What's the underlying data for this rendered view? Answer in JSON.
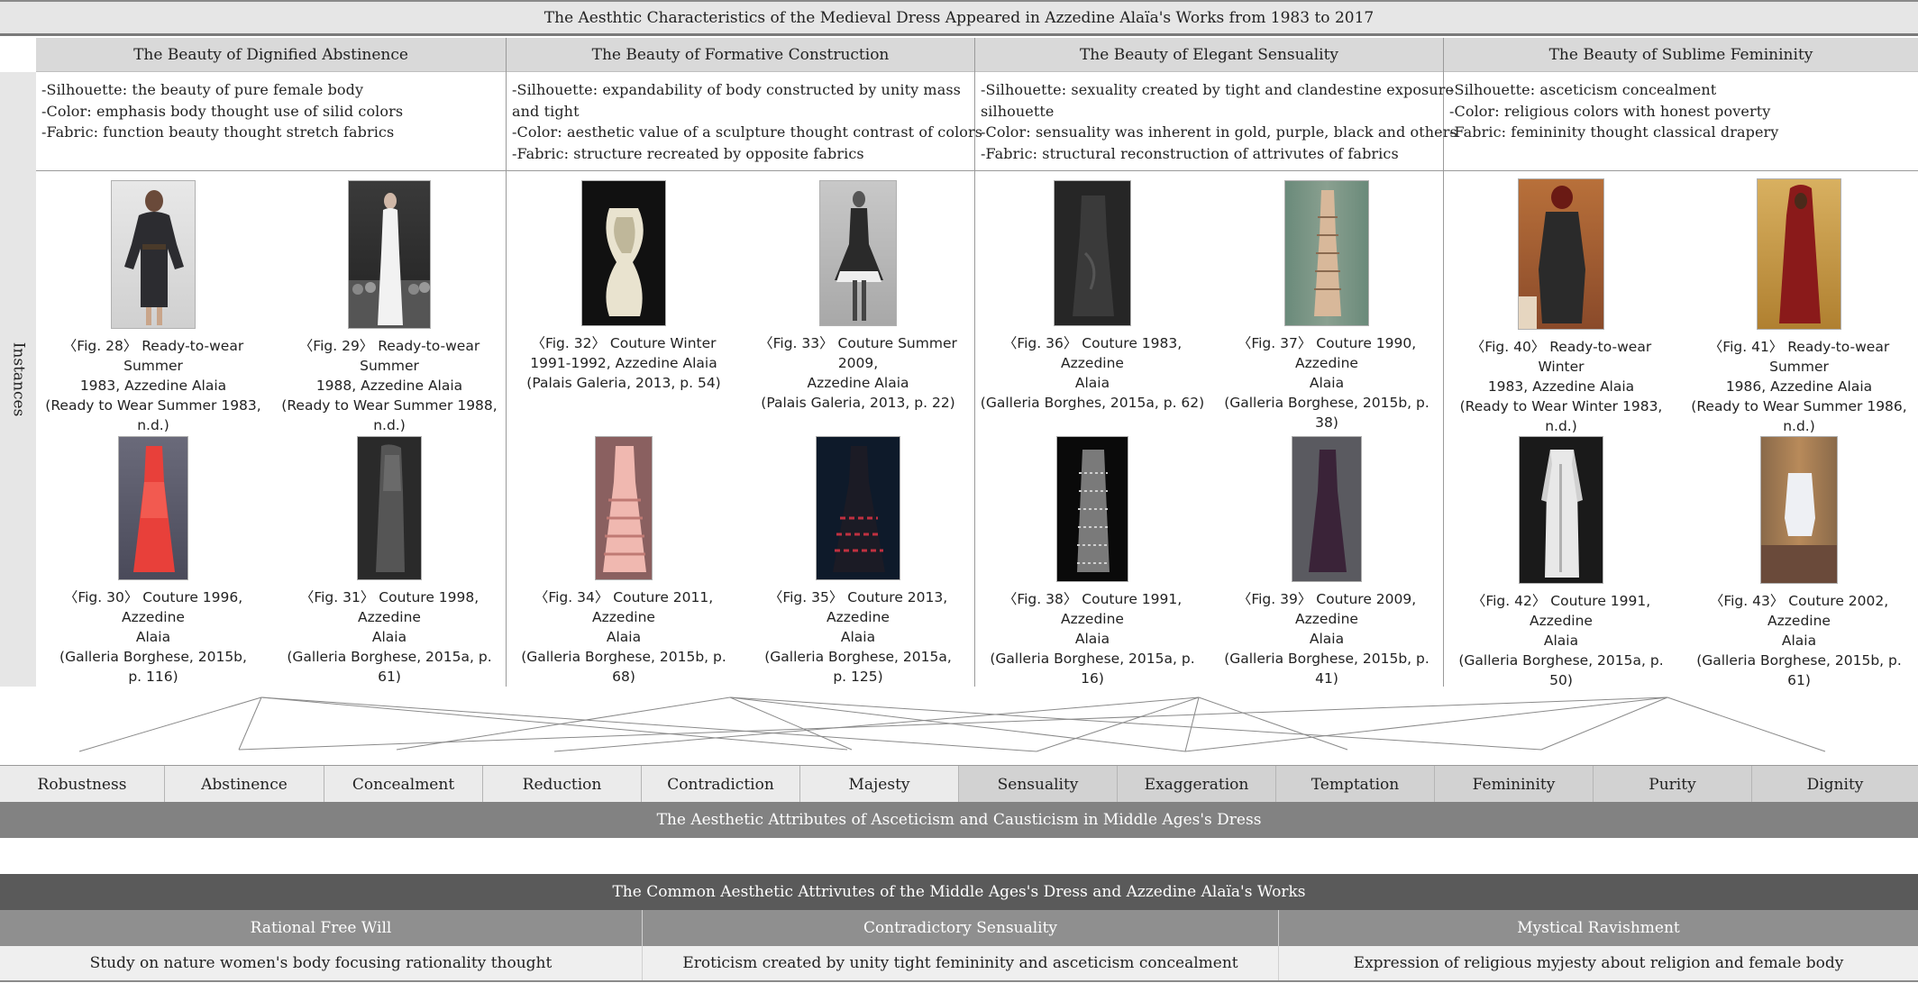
{
  "title": "The Aesthtic Characteristics of the Medieval Dress Appeared in Azzedine Alaïa's Works from 1983 to 2017",
  "instances_label": "Instances",
  "columns": [
    {
      "header": "The Beauty of Dignified Abstinence",
      "desc": [
        "-Silhouette: the beauty of pure female body",
        "-Color: emphasis body thought use of silid colors",
        "-Fabric: function beauty thought stretch fabrics"
      ],
      "figs": [
        {
          "caption": [
            "〈Fig. 28〉 Ready-to-wear Summer",
            "1983, Azzedine Alaia",
            "(Ready to Wear Summer 1983,",
            "n.d.)"
          ]
        },
        {
          "caption": [
            "〈Fig. 29〉 Ready-to-wear Summer",
            "1988, Azzedine Alaia",
            "(Ready to Wear Summer 1988,",
            "n.d.)"
          ]
        },
        {
          "caption": [
            "〈Fig. 30〉 Couture 1996, Azzedine",
            "Alaia",
            "(Galleria Borghese, 2015b,",
            "p. 116)"
          ]
        },
        {
          "caption": [
            "〈Fig. 31〉 Couture 1998, Azzedine",
            "Alaia",
            "(Galleria Borghese, 2015a, p. 61)"
          ]
        }
      ]
    },
    {
      "header": "The Beauty of Formative Construction",
      "desc": [
        "-Silhouette: expandability of body constructed by unity mass",
        " and tight",
        "-Color: aesthetic value of a sculpture thought contrast of colors",
        "-Fabric: structure recreated by opposite fabrics"
      ],
      "figs": [
        {
          "caption": [
            "〈Fig. 32〉 Couture Winter",
            "1991-1992, Azzedine Alaia",
            "(Palais Galeria, 2013, p. 54)"
          ]
        },
        {
          "caption": [
            "〈Fig. 33〉 Couture Summer 2009,",
            "Azzedine Alaia",
            "(Palais Galeria, 2013, p. 22)"
          ]
        },
        {
          "caption": [
            "〈Fig. 34〉 Couture 2011, Azzedine",
            "Alaia",
            "(Galleria Borghese, 2015b, p. 68)"
          ]
        },
        {
          "caption": [
            "〈Fig. 35〉 Couture 2013, Azzedine",
            "Alaia",
            "(Galleria Borghese, 2015a,",
            "p. 125)"
          ]
        }
      ]
    },
    {
      "header": "The Beauty of Elegant Sensuality",
      "desc": [
        "-Silhouette: sexuality created by tight and clandestine exposure",
        " silhouette",
        "-Color: sensuality was inherent in gold, purple, black and others",
        "-Fabric: structural reconstruction of attrivutes of fabrics"
      ],
      "figs": [
        {
          "caption": [
            "〈Fig. 36〉 Couture 1983, Azzedine",
            "Alaia",
            "(Galleria Borghes, 2015a, p. 62)"
          ]
        },
        {
          "caption": [
            "〈Fig. 37〉 Couture 1990, Azzedine",
            "Alaia",
            "(Galleria Borghese, 2015b, p. 38)"
          ]
        },
        {
          "caption": [
            "〈Fig. 38〉 Couture 1991, Azzedine",
            "Alaia",
            "(Galleria Borghese, 2015a, p. 16)"
          ]
        },
        {
          "caption": [
            "〈Fig. 39〉 Couture 2009, Azzedine",
            "Alaia",
            "(Galleria Borghese, 2015b, p. 41)"
          ]
        }
      ]
    },
    {
      "header": "The Beauty of Sublime Femininity",
      "desc": [
        "-Silhouette: asceticism concealment",
        "-Color: religious colors with honest poverty",
        "-Fabric: femininity thought classical drapery"
      ],
      "figs": [
        {
          "caption": [
            "〈Fig. 40〉 Ready-to-wear Winter",
            "1983, Azzedine Alaia",
            "(Ready to Wear Winter 1983,",
            "n.d.)"
          ]
        },
        {
          "caption": [
            "〈Fig. 41〉 Ready-to-wear Summer",
            "1986, Azzedine Alaia",
            "(Ready to Wear Summer 1986,",
            "n.d.)"
          ]
        },
        {
          "caption": [
            "〈Fig. 42〉 Couture 1991, Azzedine",
            "Alaia",
            "(Galleria Borghese, 2015a, p. 50)"
          ]
        },
        {
          "caption": [
            "〈Fig. 43〉 Couture 2002, Azzedine",
            "Alaia",
            "(Galleria Borghese, 2015b, p. 61)"
          ]
        }
      ]
    }
  ],
  "attributes": [
    "Robustness",
    "Abstinence",
    "Concealment",
    "Reduction",
    "Contradiction",
    "Majesty",
    "Sensuality",
    "Exaggeration",
    "Temptation",
    "Femininity",
    "Purity",
    "Dignity"
  ],
  "attributes_title": "The Aesthetic Attributes of Asceticism and Causticism in Middle Ages's Dress",
  "common": {
    "title": "The Common Aesthetic Attrivutes of the Middle Ages's Dress and Azzedine Alaïa's Works",
    "heads": [
      "Rational Free Will",
      "Contradictory Sensuality",
      "Mystical Ravishment"
    ],
    "bodies": [
      "Study on nature women's body focusing rationality thought",
      "Eroticism created by unity tight femininity and asceticism concealment",
      "Expression of religious myjesty about religion and female body"
    ]
  }
}
